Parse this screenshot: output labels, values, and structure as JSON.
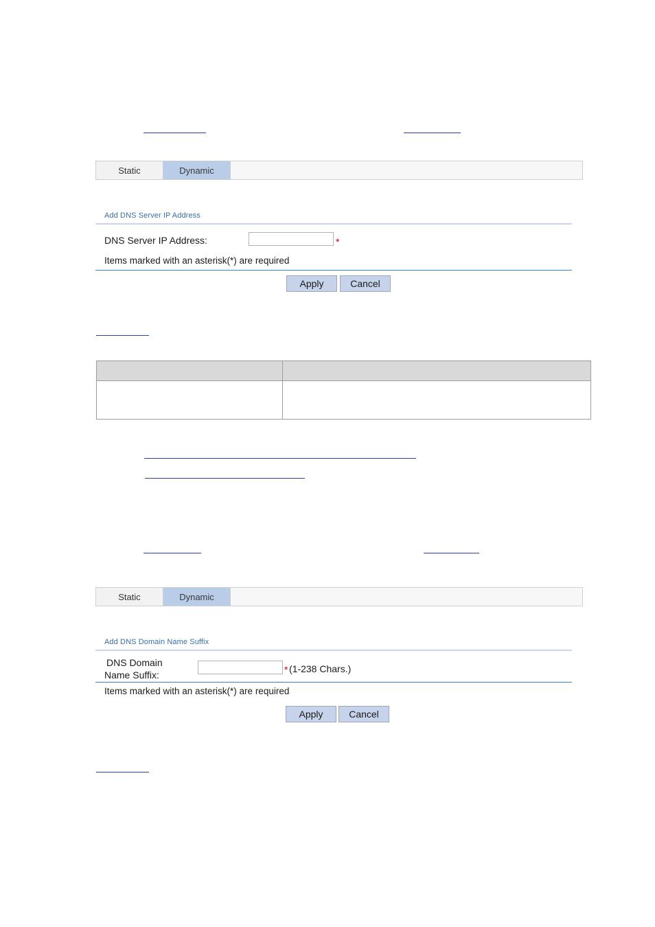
{
  "section1": {
    "links": [
      {
        "name": "ref-link-1"
      },
      {
        "name": "ref-link-2"
      }
    ],
    "tabs": [
      {
        "label": "Static",
        "state": "inactive"
      },
      {
        "label": "Dynamic",
        "state": "active"
      }
    ],
    "panel": {
      "title": "Add DNS Server IP Address",
      "field_label": "DNS Server IP Address:",
      "field_value": "",
      "field_placeholder": "",
      "required_mark": "*",
      "required_note": "Items marked with an asterisk(*) are required"
    },
    "buttons": {
      "apply": "Apply",
      "cancel": "Cancel"
    },
    "caption_link": {
      "name": "table-caption-link"
    },
    "table": {
      "headers": [
        "",
        ""
      ],
      "rows": [
        {
          "cells": [
            "",
            ""
          ]
        }
      ]
    },
    "after_table_links": [
      {
        "name": "note-link-long"
      },
      {
        "name": "note-link-short"
      }
    ]
  },
  "section2": {
    "links": [
      {
        "name": "ref-link-3"
      },
      {
        "name": "ref-link-4"
      }
    ],
    "tabs": [
      {
        "label": "Static",
        "state": "inactive"
      },
      {
        "label": "Dynamic",
        "state": "active"
      }
    ],
    "panel": {
      "title": "Add DNS Domain Name Suffix",
      "field_label_line1": "DNS Domain",
      "field_label_line2": "Name Suffix:",
      "field_value": "",
      "field_placeholder": "",
      "required_mark": "*",
      "field_hint": "(1-238 Chars.)",
      "required_note": "Items marked with an asterisk(*) are required"
    },
    "buttons": {
      "apply": "Apply",
      "cancel": "Cancel"
    },
    "caption_link": {
      "name": "table-caption-link-2"
    }
  },
  "colors": {
    "tab_active": "#b9cce8",
    "panel_title": "#3a6ea5",
    "required": "#d00000",
    "link": "#2b3f9e",
    "rule_bottom": "#3b7fd4"
  }
}
